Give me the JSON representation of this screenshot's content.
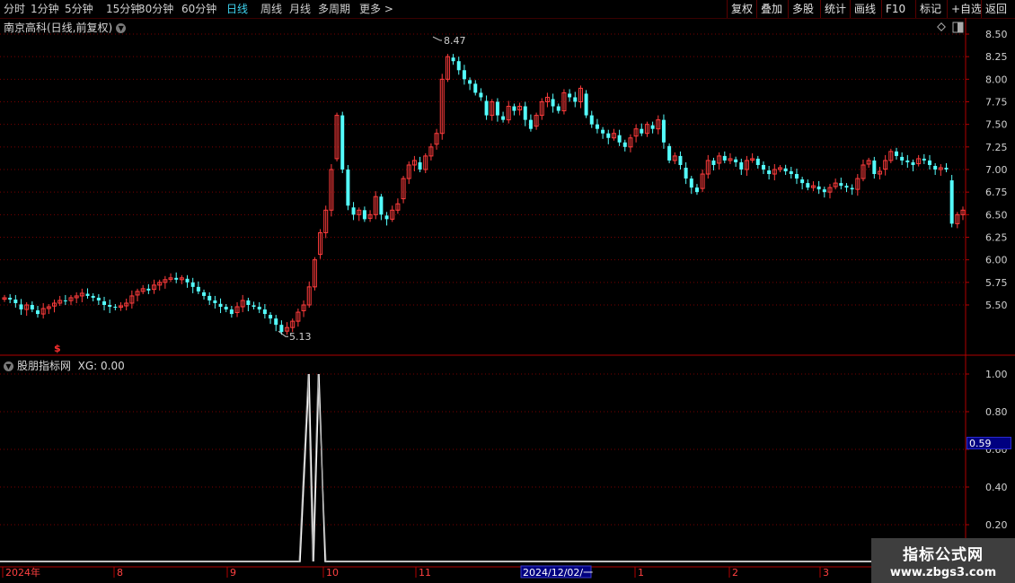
{
  "toolbar": {
    "periods": [
      "分时",
      "1分钟",
      "5分钟",
      "15分钟",
      "30分钟",
      "60分钟",
      "日线",
      "周线",
      "月线",
      "多周期",
      "更多 >"
    ],
    "active_period": "日线",
    "actions": [
      "复权",
      "叠加",
      "多股",
      "统计",
      "画线",
      "F10",
      "标记",
      "+自选",
      "返回"
    ]
  },
  "stock": {
    "title": "南京高科(日线,前复权)"
  },
  "indicator": {
    "title": "股朋指标网",
    "readout": "XG: 0.00",
    "cursor_value": "0.59"
  },
  "price_axis": {
    "ticks": [
      "8.50",
      "8.25",
      "8.00",
      "7.75",
      "7.50",
      "7.25",
      "7.00",
      "6.75",
      "6.50",
      "6.25",
      "6.00",
      "5.75",
      "5.50"
    ]
  },
  "indicator_axis": {
    "ticks": [
      "1.00",
      "0.80",
      "0.60",
      "0.40",
      "0.20"
    ]
  },
  "annotations": {
    "high": "8.47",
    "low": "5.13"
  },
  "time_axis": {
    "labels": [
      "2024年",
      "8",
      "9",
      "10",
      "11",
      "2024/12/02/一",
      "1",
      "2",
      "3"
    ]
  },
  "watermark": {
    "line1": "指标公式网",
    "line2": "www.zbgs3.com"
  },
  "colors": {
    "up": "#ff3c3c",
    "down": "#54fcfc",
    "grid": "#7a0000",
    "frame": "#b00000",
    "signal": "#ffffff"
  },
  "chart_data": {
    "type": "candlestick",
    "title": "南京高科(日线,前复权)",
    "ylim": [
      5.2,
      8.55
    ],
    "high": 8.47,
    "low": 5.13,
    "close": [
      5.58,
      5.56,
      5.52,
      5.45,
      5.5,
      5.45,
      5.4,
      5.46,
      5.48,
      5.52,
      5.55,
      5.54,
      5.58,
      5.6,
      5.63,
      5.6,
      5.58,
      5.55,
      5.5,
      5.48,
      5.47,
      5.49,
      5.52,
      5.6,
      5.65,
      5.68,
      5.66,
      5.72,
      5.75,
      5.78,
      5.8,
      5.78,
      5.8,
      5.75,
      5.7,
      5.65,
      5.6,
      5.55,
      5.52,
      5.48,
      5.45,
      5.4,
      5.48,
      5.55,
      5.5,
      5.48,
      5.45,
      5.4,
      5.35,
      5.28,
      5.2,
      5.25,
      5.32,
      5.42,
      5.5,
      5.7,
      6.0,
      6.3,
      6.55,
      7.0,
      7.6,
      7.0,
      6.6,
      6.5,
      6.55,
      6.45,
      6.5,
      6.7,
      6.5,
      6.45,
      6.55,
      6.62,
      6.9,
      7.05,
      7.1,
      7.0,
      7.15,
      7.25,
      7.4,
      8.0,
      8.25,
      8.2,
      8.1,
      8.0,
      7.95,
      7.85,
      7.8,
      7.6,
      7.75,
      7.6,
      7.55,
      7.7,
      7.65,
      7.7,
      7.55,
      7.45,
      7.6,
      7.75,
      7.8,
      7.7,
      7.65,
      7.85,
      7.8,
      7.75,
      7.9,
      7.6,
      7.5,
      7.45,
      7.4,
      7.35,
      7.4,
      7.3,
      7.25,
      7.35,
      7.45,
      7.4,
      7.5,
      7.45,
      7.55,
      7.3,
      7.1,
      7.15,
      7.05,
      6.9,
      6.8,
      6.75,
      6.95,
      7.1,
      7.05,
      7.15,
      7.1,
      7.12,
      7.08,
      7.0,
      7.1,
      7.12,
      7.05,
      7.0,
      6.95,
      7.0,
      7.02,
      6.98,
      6.95,
      6.9,
      6.85,
      6.8,
      6.82,
      6.78,
      6.75,
      6.8,
      6.85,
      6.82,
      6.8,
      6.78,
      6.9,
      7.05,
      7.1,
      6.95,
      6.98,
      7.1,
      7.2,
      7.15,
      7.1,
      7.08,
      7.05,
      7.12,
      7.1,
      7.05,
      7.0,
      7.02,
      7.0,
      6.4,
      6.5,
      6.55
    ]
  }
}
